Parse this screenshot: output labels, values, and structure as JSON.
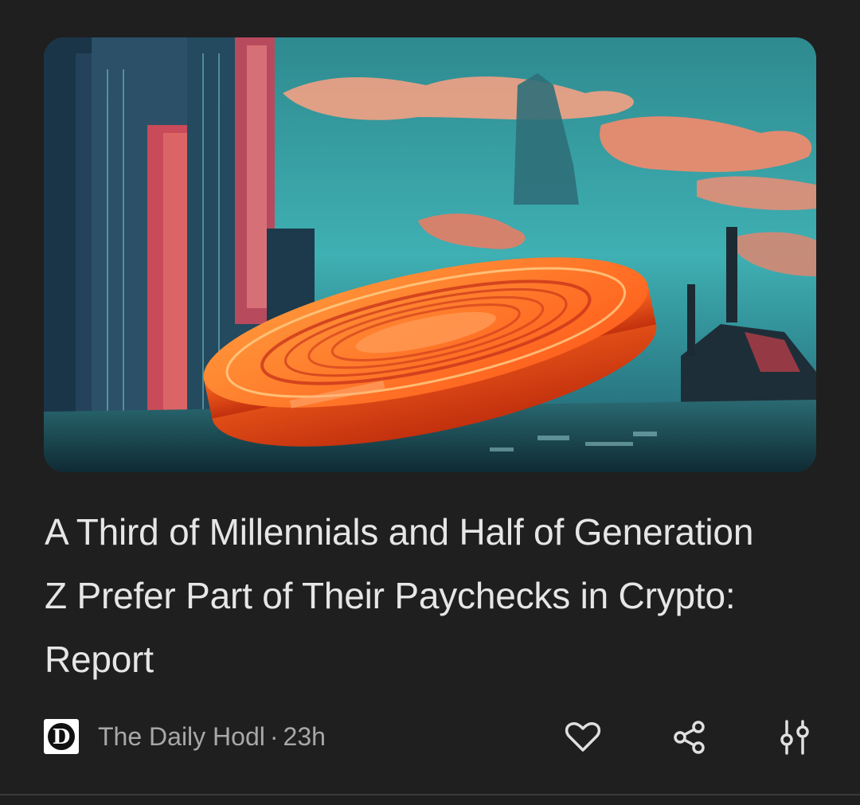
{
  "article": {
    "headline": "A Third of Millennials and Half of Generation Z Prefer Part of Their Paychecks in Crypto: Report",
    "image_icon": "news-image",
    "source": {
      "logo_letter": "D",
      "logo_icon": "the-daily-hodl-logo",
      "name": "The Daily Hodl",
      "separator": "·",
      "age": "23h"
    },
    "actions": {
      "like_icon": "heart-icon",
      "share_icon": "share-icon",
      "more_icon": "tune-icon"
    }
  },
  "colors": {
    "background": "#1f1f1f",
    "text_primary": "#e6e6e6",
    "text_secondary": "#a8a8a8"
  }
}
